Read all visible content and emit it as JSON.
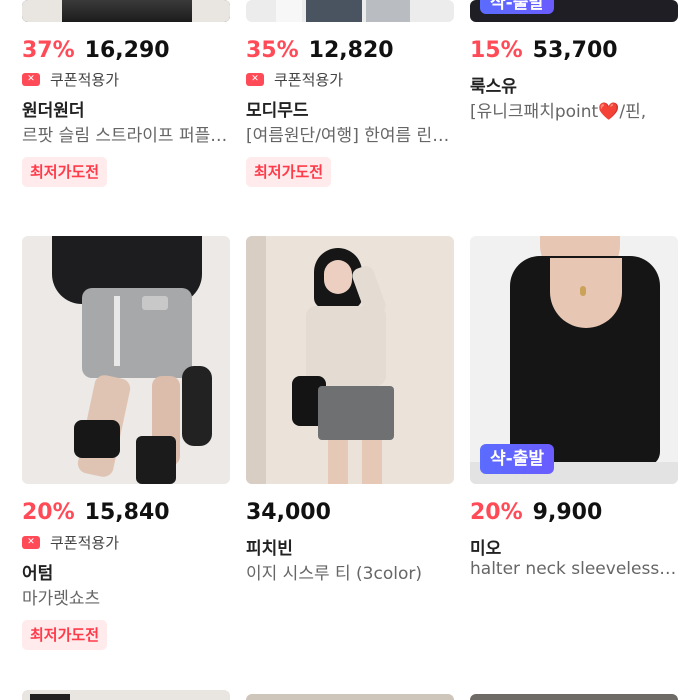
{
  "products": [
    {
      "discount": "37%",
      "price": "16,290",
      "coupon": "쿠폰적용가",
      "brand": "원더원더",
      "name": "르팟 슬림 스트라이프 퍼플 롱슬리브",
      "deal": "최저가도전"
    },
    {
      "discount": "35%",
      "price": "12,820",
      "coupon": "쿠폰적용가",
      "brand": "모디무드",
      "name": "[여름원단/여행] 한여름 린넨 셔츠",
      "deal": "최저가도전"
    },
    {
      "discount": "15%",
      "price": "53,700",
      "brand": "룩스유",
      "name": "[유니크패치point❤️/핀,",
      "ship_badge": "샥-출발"
    },
    {
      "discount": "20%",
      "price": "15,840",
      "coupon": "쿠폰적용가",
      "brand": "어텀",
      "name": "마가렛쇼츠",
      "deal": "최저가도전"
    },
    {
      "price": "34,000",
      "brand": "피치빈",
      "name": "이지 시스루 티 (3color)"
    },
    {
      "discount": "20%",
      "price": "9,900",
      "brand": "미오",
      "name": "halter neck sleeveless top",
      "ship_badge": "샥-출발"
    }
  ],
  "colors": {
    "accent": "#ff4b57",
    "deal_bg": "#ffeaec",
    "ship_badge": "#5b6cff"
  }
}
